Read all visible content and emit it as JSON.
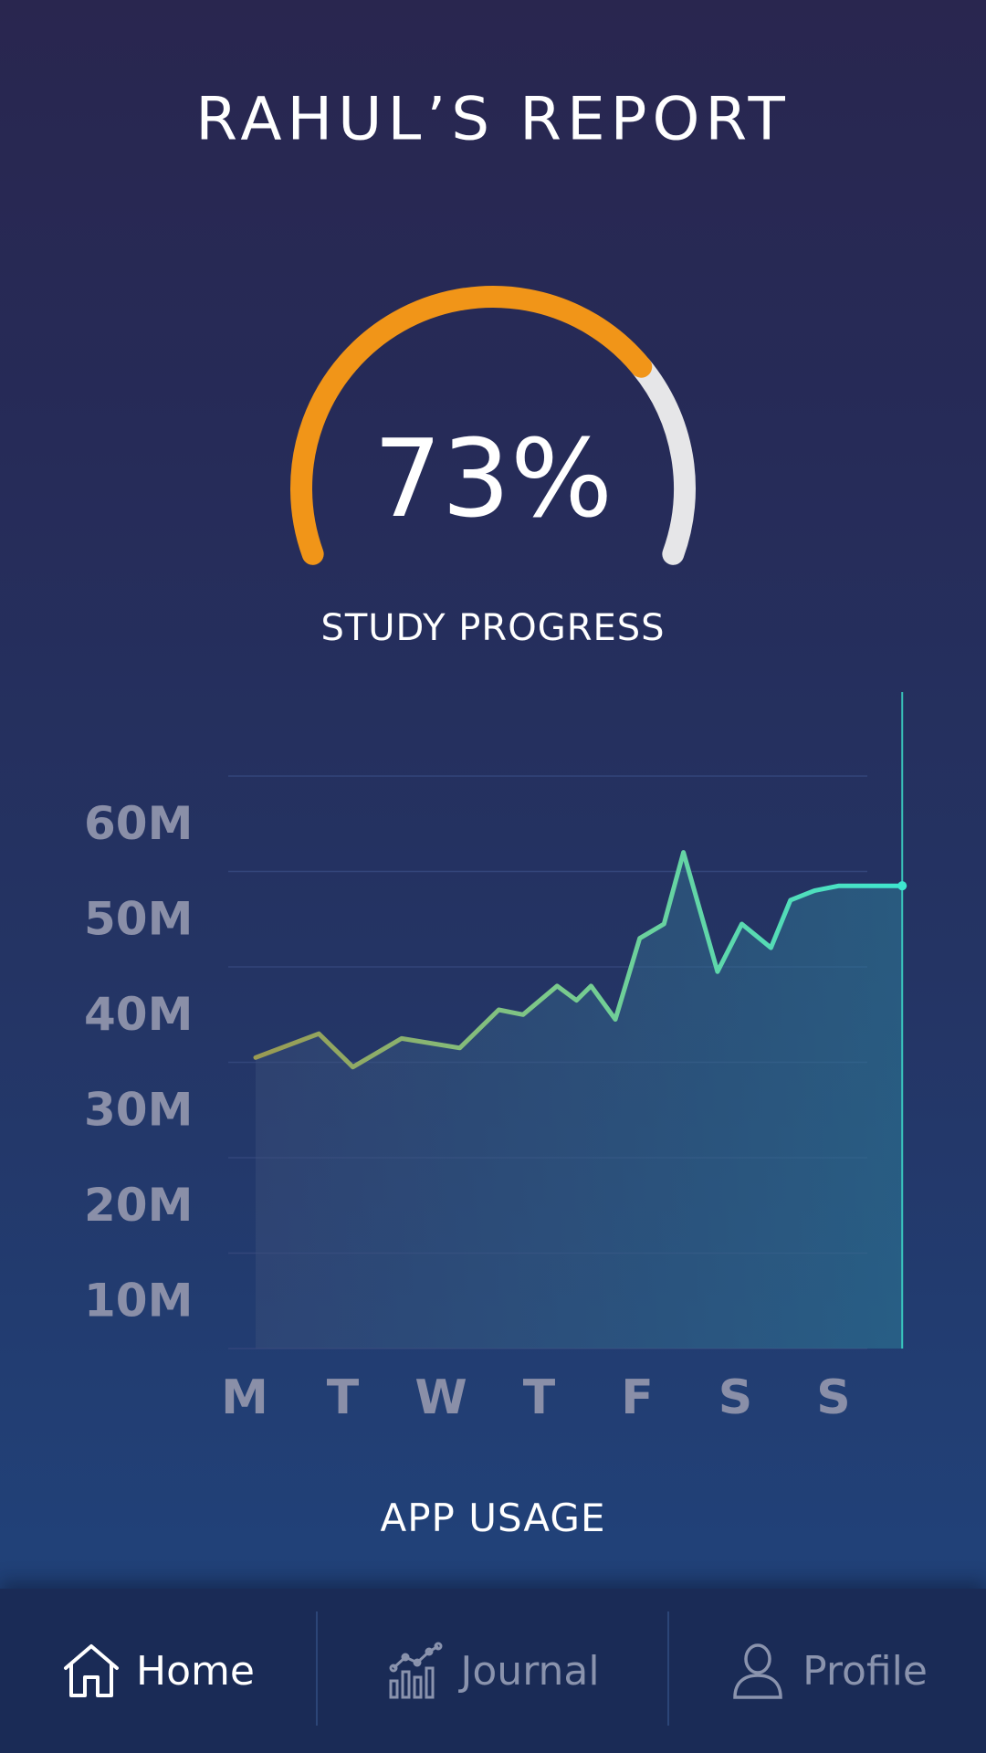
{
  "header": {
    "title": "RAHUL’S REPORT"
  },
  "progress_gauge": {
    "value_label": "73%",
    "value": 0.73,
    "label": "STUDY PROGRESS",
    "color": "#f19518",
    "track_color": "#e6e6e8"
  },
  "usage_chart": {
    "label": "APP USAGE"
  },
  "chart_data": {
    "type": "area",
    "title": "APP USAGE",
    "categories": [
      "M",
      "T",
      "W",
      "T",
      "F",
      "S",
      "S"
    ],
    "y_tick_labels": [
      "60M",
      "50M",
      "40M",
      "30M",
      "20M",
      "10M"
    ],
    "ylim": [
      0,
      70
    ],
    "grid": true,
    "series": [
      {
        "x": [
          0,
          0.65,
          1.0,
          1.5,
          2.1,
          2.5,
          2.75,
          3.1,
          3.3,
          3.45,
          3.7,
          3.95,
          4.2,
          4.4,
          4.75,
          5.0,
          5.3,
          5.5,
          5.75,
          6.0,
          6.65
        ],
        "y": [
          30.5,
          33.0,
          29.5,
          32.5,
          31.5,
          35.5,
          35.0,
          38.0,
          36.5,
          38.0,
          34.5,
          43.0,
          44.5,
          52.0,
          39.5,
          44.5,
          42.0,
          47.0,
          48.0,
          48.5,
          48.5
        ],
        "colors": [
          "#9a9a52",
          "#3ee6cf"
        ]
      }
    ]
  },
  "tabbar": {
    "items": [
      {
        "label": "Home",
        "icon": "home-icon",
        "active": true
      },
      {
        "label": "Journal",
        "icon": "chart-icon",
        "active": false
      },
      {
        "label": "Profile",
        "icon": "user-icon",
        "active": false
      }
    ]
  }
}
